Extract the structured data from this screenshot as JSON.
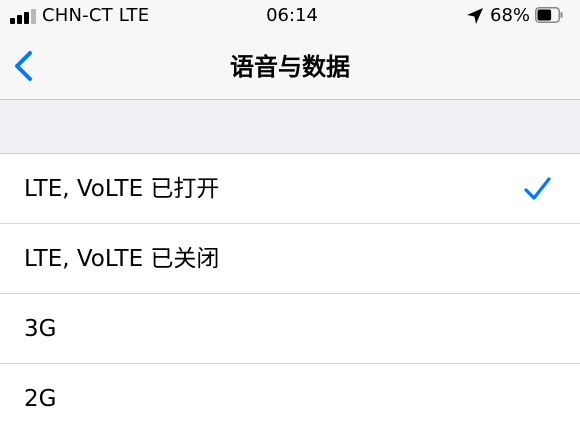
{
  "status_bar": {
    "carrier": "CHN-CT LTE",
    "time": "06:14",
    "battery_percent": "68%",
    "battery_level": 0.68,
    "signal_bars": 3,
    "icons": [
      "signal-icon",
      "location-arrow-icon",
      "battery-icon"
    ]
  },
  "nav": {
    "back_icon": "chevron-left-icon",
    "title": "语音与数据"
  },
  "options": [
    {
      "label": "LTE, VoLTE 已打开",
      "selected": true
    },
    {
      "label": "LTE, VoLTE 已关闭",
      "selected": false
    },
    {
      "label": "3G",
      "selected": false
    },
    {
      "label": "2G",
      "selected": false
    }
  ],
  "colors": {
    "accent": "#007aff",
    "background": "#efeff4",
    "bar_background": "#f7f7f7",
    "separator": "#c8c7cc"
  }
}
